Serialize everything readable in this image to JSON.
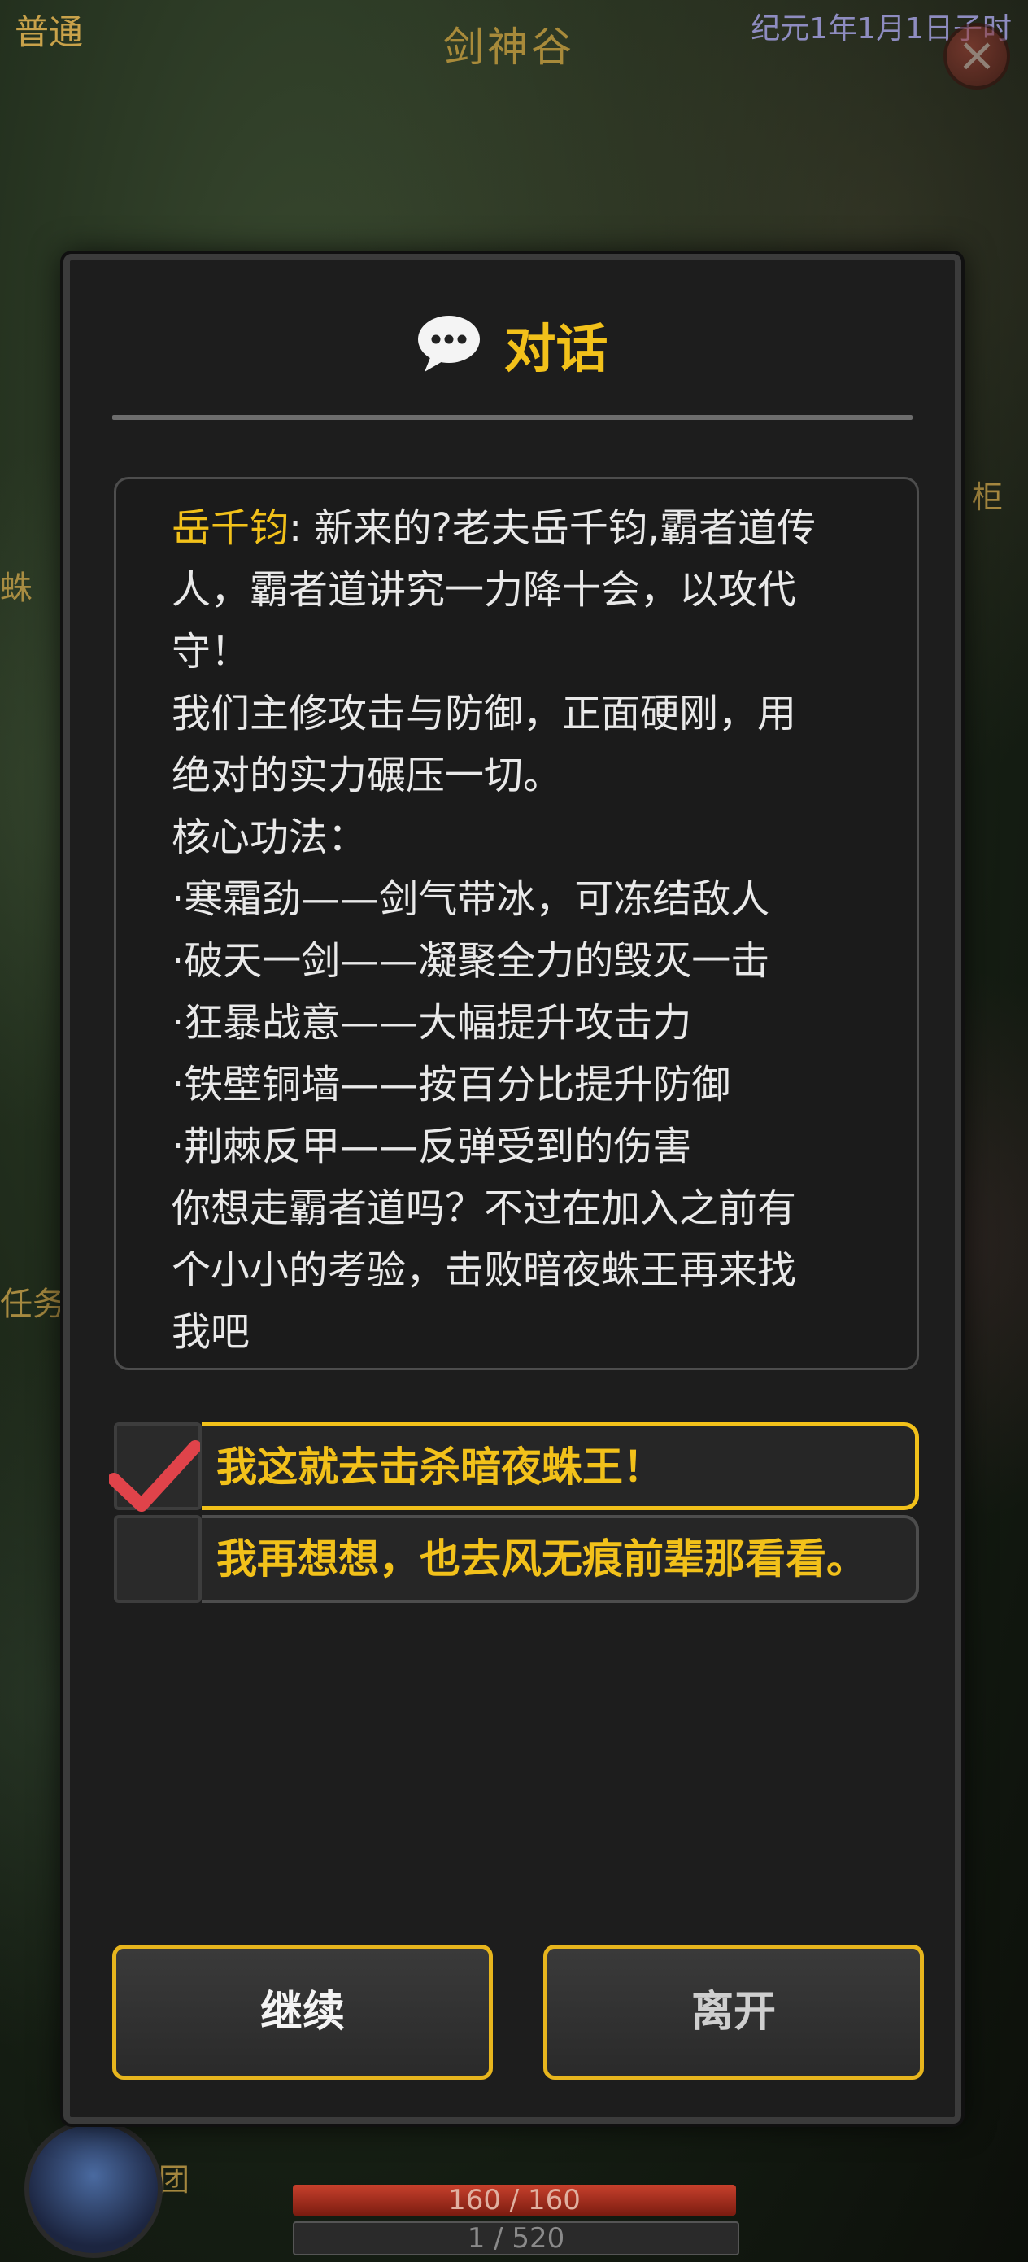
{
  "hud": {
    "mode": "普通",
    "location": "剑神谷",
    "date": "纪元1年1月1日子时",
    "side_tags": [
      "柜",
      "蛛",
      "任务",
      "团"
    ],
    "hp": "160 / 160",
    "xp": "1 / 520"
  },
  "dialog": {
    "title": "对话",
    "speaker": "岳千钧",
    "lines": [
      ": 新来的?老夫岳千钧,霸者道传",
      "人，霸者道讲究一力降十会，以攻代",
      "守！",
      "我们主修攻击与防御，正面硬刚，用",
      "绝对的实力碾压一切。",
      "核心功法：",
      "·寒霜劲——剑气带冰，可冻结敌人",
      "·破天一剑——凝聚全力的毁灭一击",
      "·狂暴战意——大幅提升攻击力",
      "·铁壁铜墙——按百分比提升防御",
      "·荆棘反甲——反弹受到的伤害",
      "你想走霸者道吗？不过在加入之前有",
      "个小小的考验，击败暗夜蛛王再来找",
      "我吧"
    ],
    "options": [
      {
        "label": "我这就去击杀暗夜蛛王！",
        "selected": true
      },
      {
        "label": "我再想想，也去风无痕前辈那看看。",
        "selected": false
      }
    ],
    "buttons": {
      "continue": "继续",
      "leave": "离开"
    }
  },
  "colors": {
    "accent": "#f2c11a",
    "text": "#e9e9e9",
    "panel": "#1d1d1d",
    "check": "#e0434a"
  }
}
